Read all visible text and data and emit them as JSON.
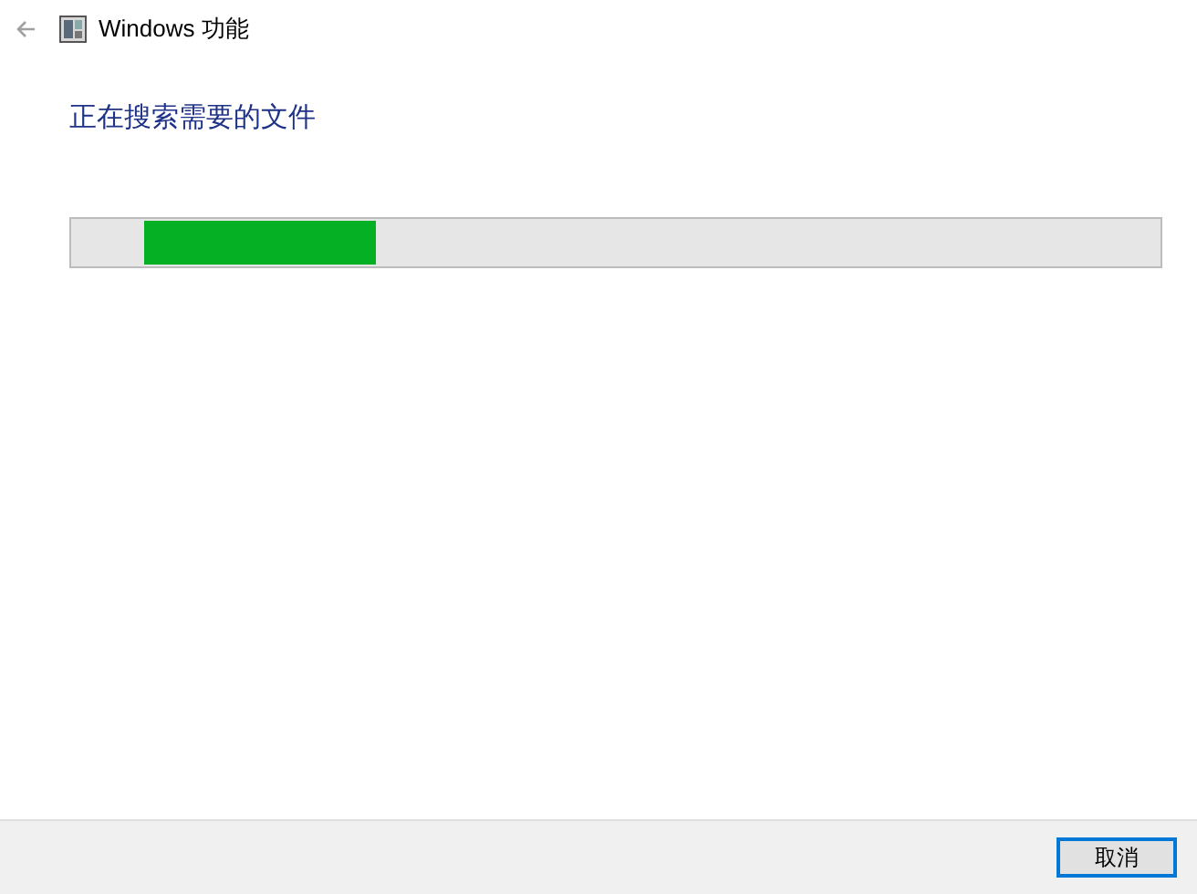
{
  "window": {
    "title": "Windows 功能"
  },
  "heading": "正在搜索需要的文件",
  "progress": {
    "indeterminate": true
  },
  "buttons": [
    {
      "label": "取消",
      "focused": true
    }
  ]
}
